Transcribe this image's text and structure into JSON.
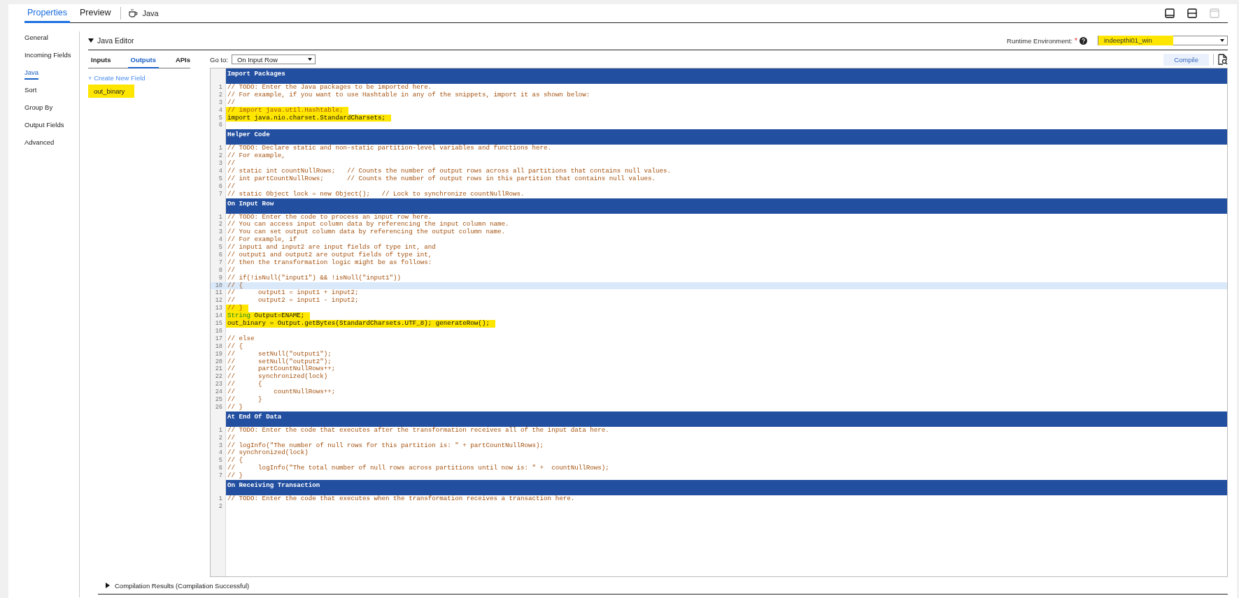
{
  "top_tabs": [
    {
      "label": "Properties",
      "selected": true
    },
    {
      "label": "Preview",
      "selected": false
    }
  ],
  "object_label": "Java",
  "view_buttons": [
    {
      "kind": "bottom-panel",
      "disabled": false
    },
    {
      "kind": "split",
      "disabled": false
    },
    {
      "kind": "maximize",
      "disabled": true
    }
  ],
  "nav": [
    {
      "label": "General",
      "selected": false
    },
    {
      "label": "Incoming Fields",
      "selected": false
    },
    {
      "label": "Java",
      "selected": true
    },
    {
      "label": "Sort",
      "selected": false
    },
    {
      "label": "Group By",
      "selected": false
    },
    {
      "label": "Output Fields",
      "selected": false
    },
    {
      "label": "Advanced",
      "selected": false
    }
  ],
  "editor": {
    "title": "Java Editor",
    "expanded": true,
    "runtime": {
      "label": "Runtime Environment:",
      "required_mark": "*",
      "value": "indeepthi01_win",
      "highlight": true
    }
  },
  "field_tabs": [
    {
      "label": "Inputs",
      "selected": false
    },
    {
      "label": "Outputs",
      "selected": true
    },
    {
      "label": "APIs",
      "selected": false
    }
  ],
  "create_link": "+ Create New Field",
  "fields": [
    {
      "name": "out_binary",
      "highlight": true
    }
  ],
  "goto": {
    "label": "Go to:",
    "value": "On Input Row"
  },
  "compile_button": "Compile",
  "sections": [
    {
      "title": "Import Packages",
      "lines": [
        {
          "n": "1",
          "kind": "comment",
          "text": "// TODO: Enter the Java packages to be imported here.",
          "highlight": false,
          "current": false
        },
        {
          "n": "2",
          "kind": "comment",
          "text": "// For example, if you want to use Hashtable in any of the snippets, import it as shown below:",
          "highlight": false,
          "current": false
        },
        {
          "n": "3",
          "kind": "comment",
          "text": "//",
          "highlight": false,
          "current": false
        },
        {
          "n": "4",
          "kind": "comment",
          "text": "// import java.util.Hashtable;",
          "highlight": true,
          "current": false
        },
        {
          "n": "5",
          "kind": "code",
          "text": "import java.nio.charset.StandardCharsets;",
          "highlight": true,
          "current": false
        },
        {
          "n": "6",
          "highlight": false,
          "current": false
        }
      ]
    },
    {
      "title": "Helper Code",
      "lines": [
        {
          "n": "1",
          "kind": "comment",
          "text": "// TODO: Declare static and non-static partition-level variables and functions here.",
          "highlight": false,
          "current": false
        },
        {
          "n": "2",
          "kind": "comment",
          "text": "// For example,",
          "highlight": false,
          "current": false
        },
        {
          "n": "3",
          "kind": "comment",
          "text": "//",
          "highlight": false,
          "current": false
        },
        {
          "n": "4",
          "kind": "comment",
          "text": "// static int countNullRows;   // Counts the number of output rows across all partitions that contains null values.",
          "highlight": false,
          "current": false
        },
        {
          "n": "5",
          "kind": "comment",
          "text": "// int partCountNullRows;      // Counts the number of output rows in this partition that contains null values.",
          "highlight": false,
          "current": false
        },
        {
          "n": "6",
          "kind": "comment",
          "text": "//",
          "highlight": false,
          "current": false
        },
        {
          "n": "7",
          "kind": "comment",
          "text": "// static Object lock = new Object();   // Lock to synchronize countNullRows.",
          "highlight": false,
          "current": false
        }
      ]
    },
    {
      "title": "On Input Row",
      "lines": [
        {
          "n": "1",
          "kind": "comment",
          "text": "// TODO: Enter the code to process an input row here.",
          "highlight": false,
          "current": false
        },
        {
          "n": "2",
          "kind": "comment",
          "text": "// You can access input column data by referencing the input column name.",
          "highlight": false,
          "current": false
        },
        {
          "n": "3",
          "kind": "comment",
          "text": "// You can set output column data by referencing the output column name.",
          "highlight": false,
          "current": false
        },
        {
          "n": "4",
          "kind": "comment",
          "text": "// For example, if",
          "highlight": false,
          "current": false
        },
        {
          "n": "5",
          "kind": "comment",
          "text": "// input1 and input2 are input fields of type int, and",
          "highlight": false,
          "current": false
        },
        {
          "n": "6",
          "kind": "comment",
          "text": "// output1 and output2 are output fields of type int,",
          "highlight": false,
          "current": false
        },
        {
          "n": "7",
          "kind": "comment",
          "text": "// then the transformation logic might be as follows:",
          "highlight": false,
          "current": false
        },
        {
          "n": "8",
          "kind": "comment",
          "text": "//",
          "highlight": false,
          "current": false
        },
        {
          "n": "9",
          "kind": "comment",
          "text": "// if(!isNull(\"input1\") && !isNull(\"input1\"))",
          "highlight": false,
          "current": false
        },
        {
          "n": "10",
          "kind": "comment",
          "text": "// {",
          "highlight": false,
          "current": true
        },
        {
          "n": "11",
          "kind": "comment",
          "text": "//      output1 = input1 + input2;",
          "highlight": false,
          "current": false
        },
        {
          "n": "12",
          "kind": "comment",
          "text": "//      output2 = input1 - input2;",
          "highlight": false,
          "current": false
        },
        {
          "n": "13",
          "kind": "comment",
          "text": "// }",
          "highlight": true,
          "current": false
        },
        {
          "n": "14",
          "kind": "code",
          "keyword": "String",
          "text": " Output=ENAME;",
          "highlight": true,
          "current": false
        },
        {
          "n": "15",
          "kind": "code",
          "text": "out_binary = Output.getBytes(StandardCharsets.UTF_8); generateRow();",
          "highlight": true,
          "current": false
        },
        {
          "n": "16",
          "highlight": false,
          "current": false
        },
        {
          "n": "17",
          "kind": "comment",
          "text": "// else",
          "highlight": false,
          "current": false
        },
        {
          "n": "18",
          "kind": "comment",
          "text": "// {",
          "highlight": false,
          "current": false
        },
        {
          "n": "19",
          "kind": "comment",
          "text": "//      setNull(\"output1\");",
          "highlight": false,
          "current": false
        },
        {
          "n": "20",
          "kind": "comment",
          "text": "//      setNull(\"output2\");",
          "highlight": false,
          "current": false
        },
        {
          "n": "21",
          "kind": "comment",
          "text": "//      partCountNullRows++;",
          "highlight": false,
          "current": false
        },
        {
          "n": "22",
          "kind": "comment",
          "text": "//      synchronized(lock)",
          "highlight": false,
          "current": false
        },
        {
          "n": "23",
          "kind": "comment",
          "text": "//      {",
          "highlight": false,
          "current": false
        },
        {
          "n": "24",
          "kind": "comment",
          "text": "//          countNullRows++;",
          "highlight": false,
          "current": false
        },
        {
          "n": "25",
          "kind": "comment",
          "text": "//      }",
          "highlight": false,
          "current": false
        },
        {
          "n": "26",
          "kind": "comment",
          "text": "// }",
          "highlight": false,
          "current": false
        }
      ]
    },
    {
      "title": "At End Of Data",
      "lines": [
        {
          "n": "1",
          "kind": "comment",
          "text": "// TODO: Enter the code that executes after the transformation receives all of the input data here.",
          "highlight": false,
          "current": false
        },
        {
          "n": "2",
          "kind": "comment",
          "text": "//",
          "highlight": false,
          "current": false
        },
        {
          "n": "3",
          "kind": "comment",
          "text": "// logInfo(\"The number of null rows for this partition is: \" + partCountNullRows);",
          "highlight": false,
          "current": false
        },
        {
          "n": "4",
          "kind": "comment",
          "text": "// synchronized(lock)",
          "highlight": false,
          "current": false
        },
        {
          "n": "5",
          "kind": "comment",
          "text": "// {",
          "highlight": false,
          "current": false
        },
        {
          "n": "6",
          "kind": "comment",
          "text": "//      logInfo(\"The total number of null rows across partitions until now is: \" +  countNullRows);",
          "highlight": false,
          "current": false
        },
        {
          "n": "7",
          "kind": "comment",
          "text": "// }",
          "highlight": false,
          "current": false
        }
      ]
    },
    {
      "title": "On Receiving Transaction",
      "lines": [
        {
          "n": "1",
          "kind": "comment",
          "text": "// TODO: Enter the code that executes when the transformation receives a transaction here.",
          "highlight": false,
          "current": false
        },
        {
          "n": "2",
          "highlight": false,
          "current": false
        }
      ]
    }
  ],
  "compilation": {
    "label": "Compilation Results (Compilation Successful)",
    "expanded": false
  }
}
